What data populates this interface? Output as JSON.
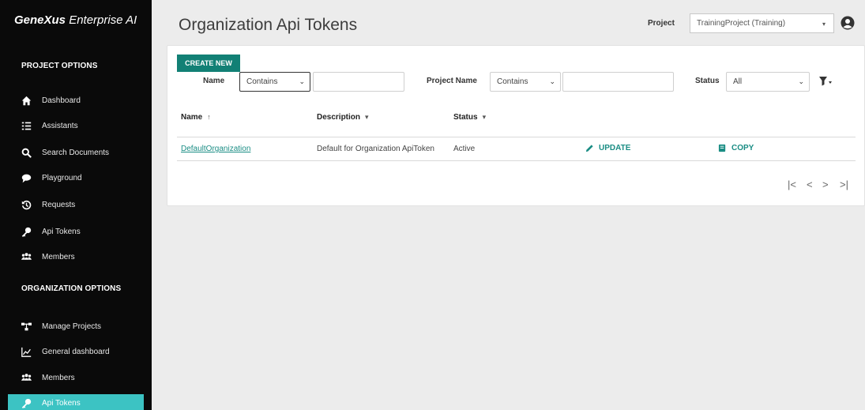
{
  "brand": {
    "name": "GeneXus",
    "suffix": "Enterprise AI"
  },
  "sidebar": {
    "project_section": "PROJECT OPTIONS",
    "project_items": [
      {
        "label": "Dashboard",
        "icon": "home-icon"
      },
      {
        "label": "Assistants",
        "icon": "list-icon"
      },
      {
        "label": "Search Documents",
        "icon": "search-icon"
      },
      {
        "label": "Playground",
        "icon": "chat-icon"
      },
      {
        "label": "Requests",
        "icon": "history-icon"
      },
      {
        "label": "Api Tokens",
        "icon": "key-icon"
      },
      {
        "label": "Members",
        "icon": "users-icon"
      }
    ],
    "org_section": "ORGANIZATION OPTIONS",
    "org_items": [
      {
        "label": "Manage Projects",
        "icon": "sitemap-icon"
      },
      {
        "label": "General dashboard",
        "icon": "chart-icon"
      },
      {
        "label": "Members",
        "icon": "users-icon"
      },
      {
        "label": "Api Tokens",
        "icon": "key-icon",
        "active": true
      }
    ]
  },
  "header": {
    "title": "Organization Api Tokens",
    "project_label": "Project",
    "project_value": "TrainingProject (Training)"
  },
  "toolbar": {
    "create_label": "CREATE NEW"
  },
  "filters": {
    "name_label": "Name",
    "name_operator": "Contains",
    "name_value": "",
    "project_label": "Project Name",
    "project_operator": "Contains",
    "project_value": "",
    "status_label": "Status",
    "status_value": "All"
  },
  "table": {
    "columns": [
      {
        "label": "Name",
        "sort": "↑"
      },
      {
        "label": "Description",
        "sort": "▾"
      },
      {
        "label": "Status",
        "sort": "▾"
      }
    ],
    "rows": [
      {
        "name": "DefaultOrganization",
        "description": "Default for Organization ApiToken",
        "status": "Active",
        "update_label": "UPDATE",
        "copy_label": "COPY"
      }
    ]
  },
  "pager": {
    "first": "|<",
    "prev": "<",
    "next": ">",
    "last": ">|"
  },
  "colors": {
    "accent": "#128075",
    "active_nav": "#3cc3c3",
    "sidebar_bg": "#0a0a0a"
  }
}
